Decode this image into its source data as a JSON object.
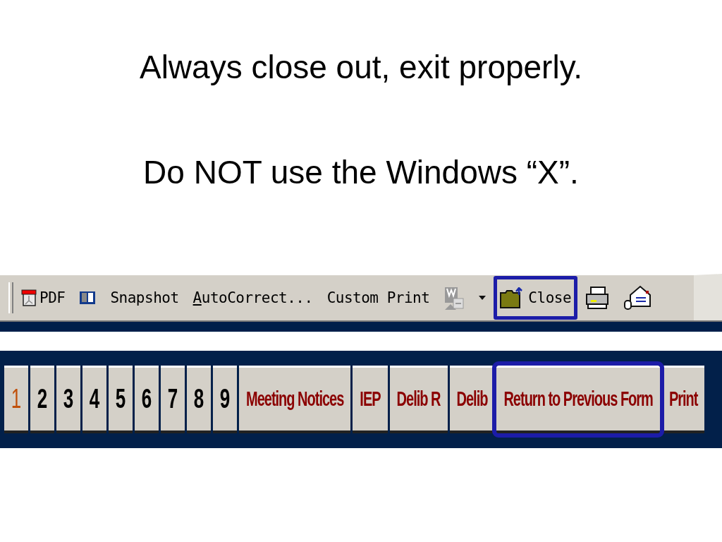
{
  "slide": {
    "lines": [
      "Always close out, exit properly.",
      "Do NOT use the Windows “X”."
    ]
  },
  "toolbar": {
    "items": [
      {
        "kind": "pdf",
        "label": "PDF",
        "highlighted": false
      },
      {
        "kind": "book",
        "highlighted": false
      },
      {
        "kind": "text",
        "label": "Snapshot",
        "highlighted": false
      },
      {
        "kind": "text",
        "label": "AutoCorrect...",
        "underline_first": true,
        "highlighted": false
      },
      {
        "kind": "text",
        "label": "Custom Print",
        "highlighted": false
      },
      {
        "kind": "chart",
        "highlighted": false
      },
      {
        "kind": "dropdown",
        "highlighted": false
      },
      {
        "kind": "folder",
        "label": "Close",
        "highlighted": true
      },
      {
        "kind": "printer",
        "highlighted": false
      },
      {
        "kind": "mail",
        "highlighted": false
      }
    ]
  },
  "form_buttons": [
    {
      "label": "1",
      "selected": true,
      "highlighted": false
    },
    {
      "label": "2",
      "selected": false,
      "highlighted": false
    },
    {
      "label": "3",
      "selected": false,
      "highlighted": false
    },
    {
      "label": "4",
      "selected": false,
      "highlighted": false
    },
    {
      "label": "5",
      "selected": false,
      "highlighted": false
    },
    {
      "label": "6",
      "selected": false,
      "highlighted": false
    },
    {
      "label": "7",
      "selected": false,
      "highlighted": false
    },
    {
      "label": "8",
      "selected": false,
      "highlighted": false
    },
    {
      "label": "9",
      "selected": false,
      "highlighted": false
    },
    {
      "label": "Meeting Notices",
      "selected": false,
      "highlighted": false,
      "kind": "form"
    },
    {
      "label": "IEP",
      "selected": false,
      "highlighted": false,
      "kind": "form"
    },
    {
      "label": "Delib R",
      "selected": false,
      "highlighted": false,
      "kind": "form"
    },
    {
      "label": "Delib",
      "selected": false,
      "highlighted": false,
      "kind": "form"
    },
    {
      "label": "Return to Previous Form",
      "selected": false,
      "highlighted": true,
      "kind": "form"
    },
    {
      "label": "Print",
      "selected": false,
      "highlighted": false,
      "kind": "form"
    }
  ]
}
